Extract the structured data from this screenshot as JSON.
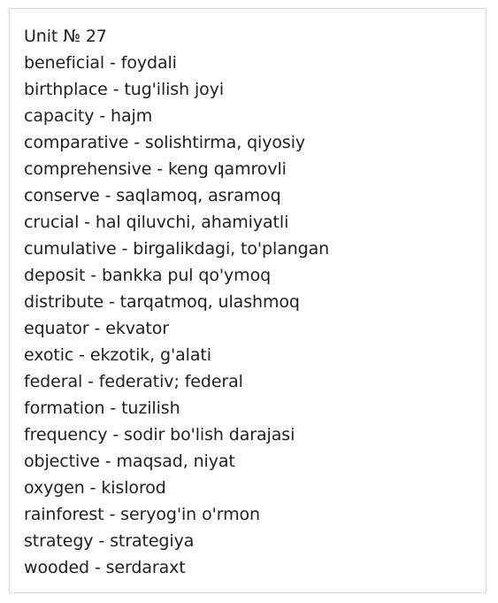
{
  "title": "Unit № 27",
  "entries": [
    "beneficial - foydali",
    "birthplace - tug'ilish joyi",
    "capacity - hajm",
    "comparative - solishtirma, qiyosiy",
    "comprehensive - keng qamrovli",
    "conserve - saqlamoq, asramoq",
    "crucial - hal qiluvchi, ahamiyatli",
    "cumulative - birgalikdagi, to'plangan",
    "deposit - bankka pul qo'ymoq",
    "distribute - tarqatmoq, ulashmoq",
    "equator - ekvator",
    "exotic - ekzotik, g'alati",
    "federal - federativ; federal",
    "formation - tuzilish",
    "frequency - sodir bo'lish darajasi",
    "objective - maqsad, niyat",
    "oxygen - kislorod",
    "rainforest - seryog'in o'rmon",
    "strategy - strategiya",
    "wooded - serdaraxt"
  ]
}
